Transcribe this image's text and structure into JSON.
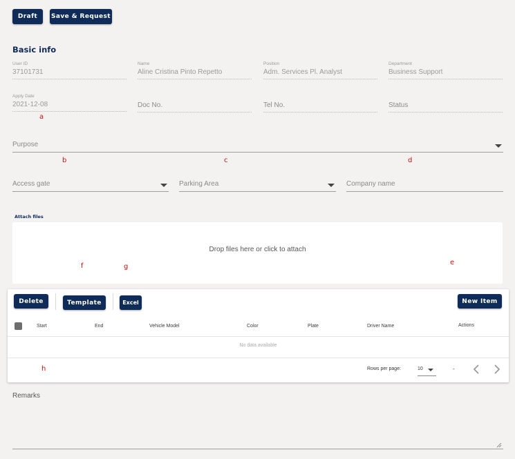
{
  "toolbar": {
    "draft_label": "Draft",
    "save_request_label": "Save & Request"
  },
  "basic_info": {
    "title": "Basic info",
    "fields": [
      {
        "label": "User ID",
        "value": "37101731"
      },
      {
        "label": "Name",
        "value": "Aline Cristina Pinto Repetto"
      },
      {
        "label": "Position",
        "value": "Adm. Services Pl. Analyst"
      },
      {
        "label": "Department",
        "value": "Business Support"
      },
      {
        "label": "Apply Date",
        "value": "2021-12-08"
      }
    ],
    "doc_no_placeholder": "Doc No.",
    "tel_no_placeholder": "Tel No.",
    "status_placeholder": "Status",
    "purpose_placeholder": "Purpose",
    "access_gate_placeholder": "Access gate",
    "parking_area_placeholder": "Parking Area",
    "company_name_placeholder": "Company name"
  },
  "attach": {
    "label": "Attach files",
    "dropzone_text": "Drop files here or click to attach"
  },
  "table": {
    "delete_label": "Delete",
    "template_label": "Template",
    "excel_label": "Excel",
    "new_item_label": "New Item",
    "columns": [
      "Start",
      "End",
      "Vehicle Model",
      "Color",
      "Plate",
      "Driver Name",
      "Actions"
    ],
    "empty_text": "No data available",
    "rows_per_page_label": "Rows per page:",
    "rows_per_page_value": "10",
    "page_range": "-"
  },
  "remarks": {
    "label": "Remarks"
  },
  "annotations": [
    "a",
    "b",
    "c",
    "d",
    "e",
    "f",
    "g",
    "h"
  ],
  "colors": {
    "primary": "#0f2b57",
    "background": "#f4f1f1",
    "annotation": "#c0150f"
  }
}
